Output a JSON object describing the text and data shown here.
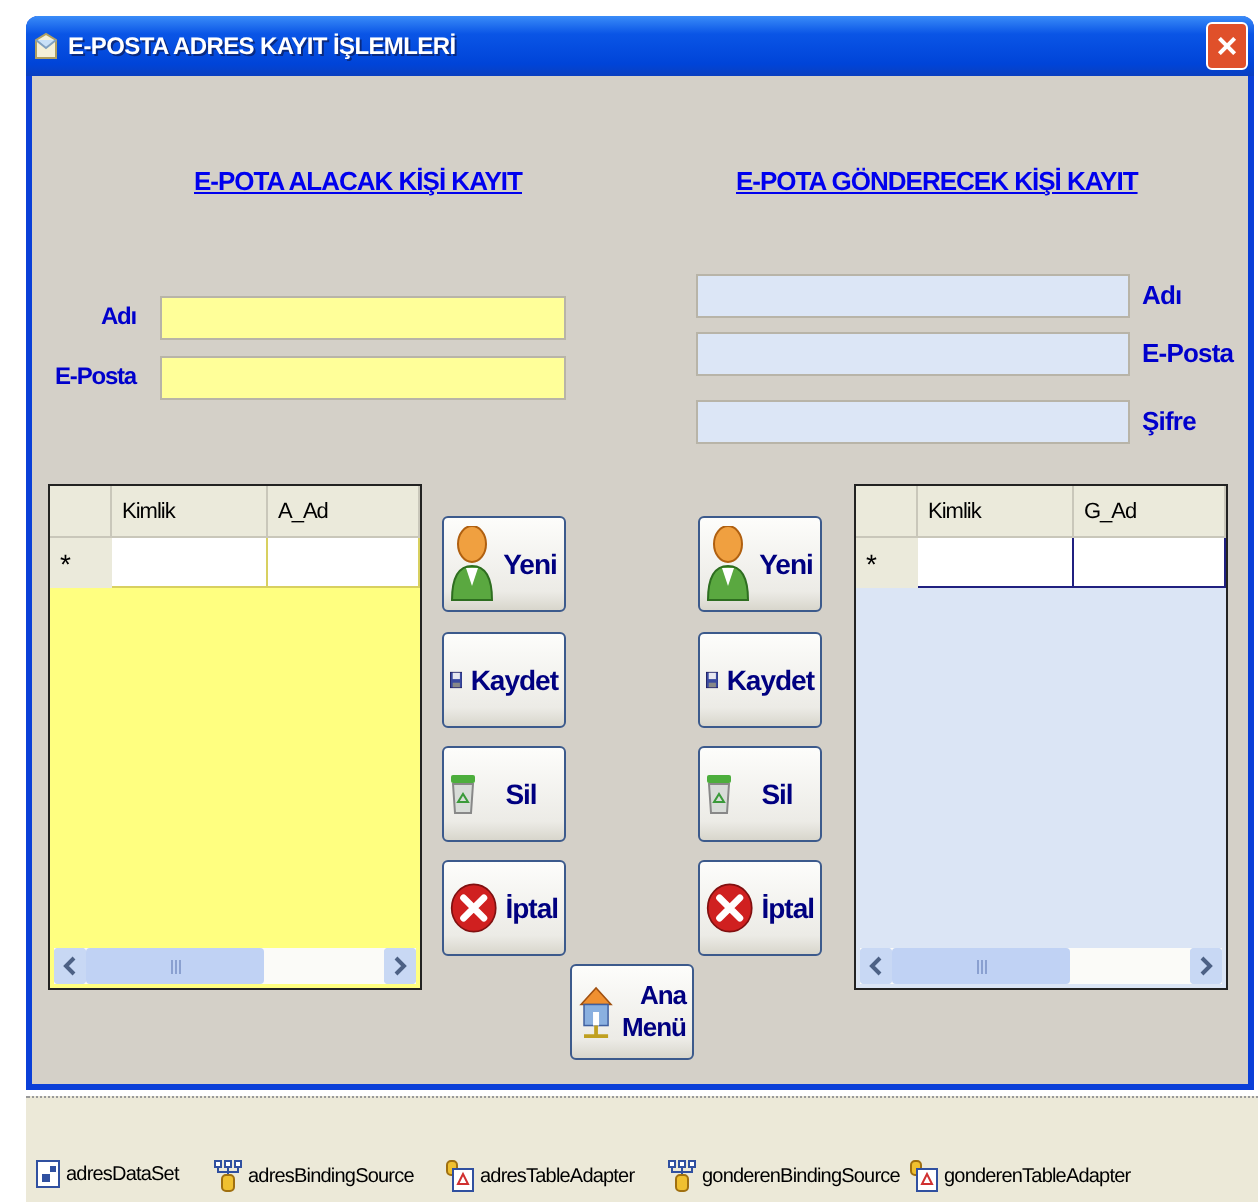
{
  "window": {
    "title": "E-POSTA ADRES KAYIT İŞLEMLERİ",
    "close": "×"
  },
  "receiver_panel": {
    "heading": "E-POTA ALACAK KİŞİ KAYIT",
    "fields": [
      {
        "label": "Adı"
      },
      {
        "label": "E-Posta"
      }
    ],
    "grid": {
      "columns": [
        "Kimlik",
        "A_Ad"
      ],
      "new_row_marker": "*"
    },
    "buttons": [
      {
        "kind": "new",
        "label": "Yeni"
      },
      {
        "kind": "save",
        "label": "Kaydet"
      },
      {
        "kind": "delete",
        "label": "Sil"
      },
      {
        "kind": "cancel",
        "label": "İptal"
      }
    ]
  },
  "sender_panel": {
    "heading": "E-POTA GÖNDERECEK KİŞİ KAYIT",
    "fields": [
      {
        "label": "Adı"
      },
      {
        "label": "E-Posta"
      },
      {
        "label": "Şifre"
      }
    ],
    "grid": {
      "columns": [
        "Kimlik",
        "G_Ad"
      ],
      "new_row_marker": "*"
    },
    "buttons": [
      {
        "kind": "new",
        "label": "Yeni"
      },
      {
        "kind": "save",
        "label": "Kaydet"
      },
      {
        "kind": "delete",
        "label": "Sil"
      },
      {
        "kind": "cancel",
        "label": "İptal"
      }
    ]
  },
  "main_menu_button": {
    "label_lines": [
      "Ana",
      "Menü"
    ]
  },
  "component_tray": [
    {
      "kind": "dataset",
      "label": "adresDataSet"
    },
    {
      "kind": "binding_source",
      "label": "adresBindingSource"
    },
    {
      "kind": "table_adapter",
      "label": "adresTableAdapter"
    },
    {
      "kind": "binding_source",
      "label": "gonderenBindingSource"
    },
    {
      "kind": "table_adapter",
      "label": "gonderenTableAdapter"
    }
  ]
}
